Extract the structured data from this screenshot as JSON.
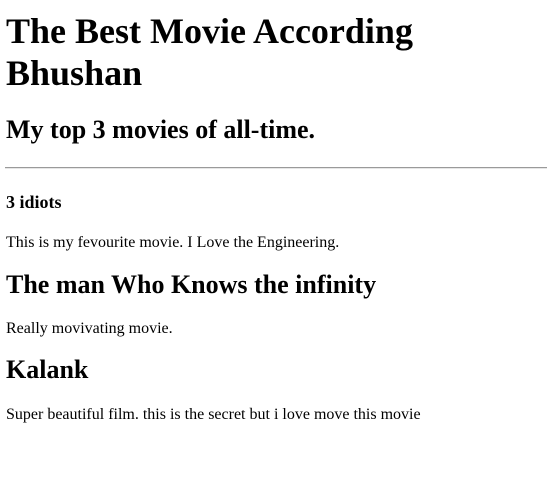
{
  "header": {
    "title": "The Best Movie According Bhushan",
    "subtitle": "My top 3 movies of all-time."
  },
  "movies": [
    {
      "title": "3 idiots",
      "description": "This is my fevourite movie. I Love the Engineering."
    },
    {
      "title": "The man Who Knows the infinity",
      "description": "Really movivating movie."
    },
    {
      "title": "Kalank",
      "description": "Super beautiful film. this is the secret but i love move this movie"
    }
  ]
}
